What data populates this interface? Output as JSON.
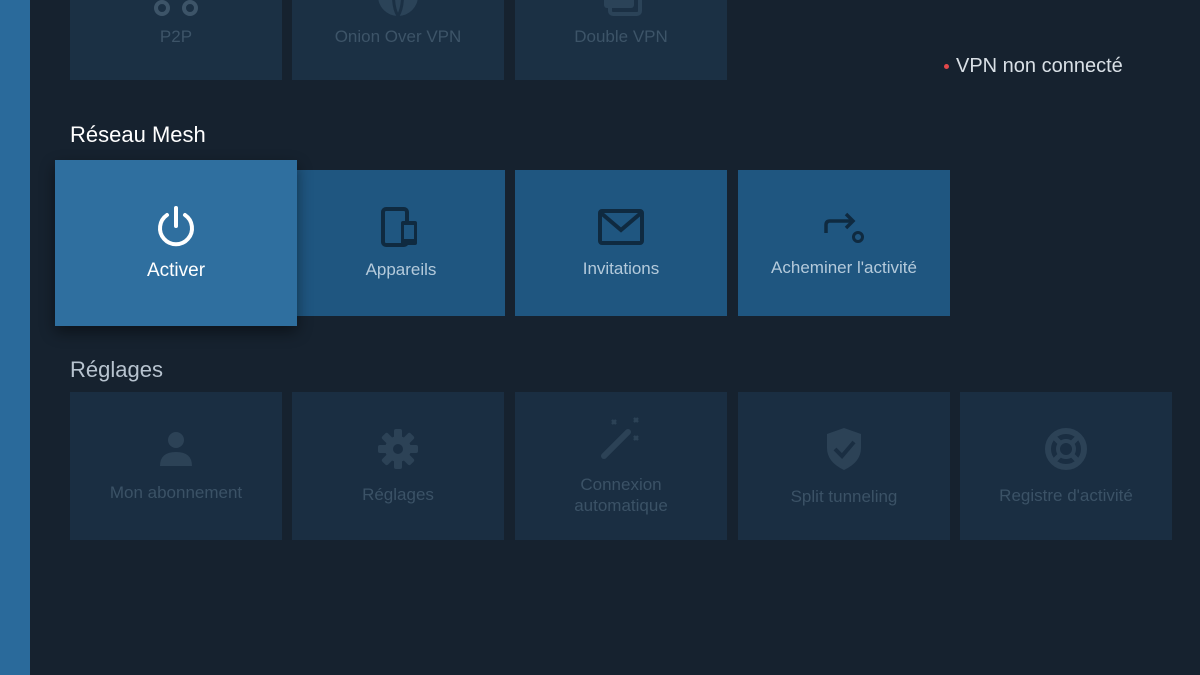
{
  "status": {
    "text": "VPN non connecté",
    "dot_color": "#e1474a"
  },
  "top_row": [
    {
      "label": "P2P",
      "icon": "p2p-icon"
    },
    {
      "label": "Onion Over VPN",
      "icon": "onion-icon"
    },
    {
      "label": "Double VPN",
      "icon": "double-vpn-icon"
    }
  ],
  "mesh": {
    "title": "Réseau Mesh",
    "tiles": [
      {
        "label": "Activer",
        "icon": "power-icon"
      },
      {
        "label": "Appareils",
        "icon": "devices-icon"
      },
      {
        "label": "Invitations",
        "icon": "envelope-icon"
      },
      {
        "label": "Acheminer l'activité",
        "icon": "route-icon"
      }
    ]
  },
  "settings": {
    "title": "Réglages",
    "tiles": [
      {
        "label": "Mon abonnement",
        "icon": "user-icon"
      },
      {
        "label": "Réglages",
        "icon": "gear-icon"
      },
      {
        "label": "Connexion automatique",
        "icon": "magic-wand-icon"
      },
      {
        "label": "Split tunneling",
        "icon": "shield-check-icon"
      },
      {
        "label": "Registre d'activité",
        "icon": "lifebuoy-icon"
      }
    ]
  },
  "colors": {
    "background": "#16222f",
    "rail": "#2a6a9b",
    "focused_tile": "#2f6f9f",
    "mesh_tile": "#1f5680"
  }
}
